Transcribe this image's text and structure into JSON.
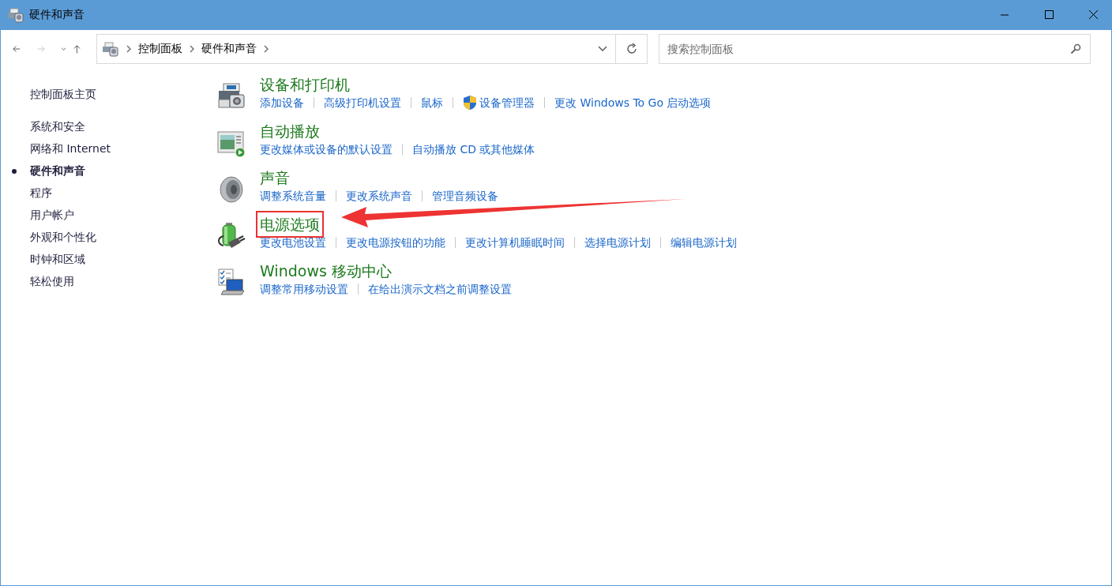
{
  "window": {
    "title": "硬件和声音"
  },
  "nav_buttons": [
    {
      "kind": "back",
      "disabled": false
    },
    {
      "kind": "forward",
      "disabled": true
    },
    {
      "kind": "recent",
      "disabled": false
    },
    {
      "kind": "up",
      "disabled": false
    }
  ],
  "address": {
    "breadcrumbs": [
      "控制面板",
      "硬件和声音"
    ]
  },
  "search": {
    "placeholder": "搜索控制面板"
  },
  "sidebar": {
    "home": "控制面板主页",
    "items": [
      {
        "label": "系统和安全",
        "selected": false
      },
      {
        "label": "网络和 Internet",
        "selected": false
      },
      {
        "label": "硬件和声音",
        "selected": true
      },
      {
        "label": "程序",
        "selected": false
      },
      {
        "label": "用户帐户",
        "selected": false
      },
      {
        "label": "外观和个性化",
        "selected": false
      },
      {
        "label": "时钟和区域",
        "selected": false
      },
      {
        "label": "轻松使用",
        "selected": false
      }
    ]
  },
  "categories": [
    {
      "kind": "printer",
      "title": "设备和打印机",
      "highlighted": false,
      "links": [
        {
          "label": "添加设备",
          "shield": false
        },
        {
          "label": "高级打印机设置",
          "shield": false
        },
        {
          "label": "鼠标",
          "shield": false
        },
        {
          "label": "设备管理器",
          "shield": true
        },
        {
          "label": "更改 Windows To Go 启动选项",
          "shield": false
        }
      ]
    },
    {
      "kind": "autoplay",
      "title": "自动播放",
      "highlighted": false,
      "links": [
        {
          "label": "更改媒体或设备的默认设置",
          "shield": false
        },
        {
          "label": "自动播放 CD 或其他媒体",
          "shield": false
        }
      ]
    },
    {
      "kind": "sound",
      "title": "声音",
      "highlighted": false,
      "links": [
        {
          "label": "调整系统音量",
          "shield": false
        },
        {
          "label": "更改系统声音",
          "shield": false
        },
        {
          "label": "管理音频设备",
          "shield": false
        }
      ]
    },
    {
      "kind": "power",
      "title": "电源选项",
      "highlighted": true,
      "links": [
        {
          "label": "更改电池设置",
          "shield": false
        },
        {
          "label": "更改电源按钮的功能",
          "shield": false
        },
        {
          "label": "更改计算机睡眠时间",
          "shield": false
        },
        {
          "label": "选择电源计划",
          "shield": false
        },
        {
          "label": "编辑电源计划",
          "shield": false
        }
      ]
    },
    {
      "kind": "mobility",
      "title": "Windows 移动中心",
      "highlighted": false,
      "links": [
        {
          "label": "调整常用移动设置",
          "shield": false
        },
        {
          "label": "在给出演示文档之前调整设置",
          "shield": false
        }
      ]
    }
  ]
}
